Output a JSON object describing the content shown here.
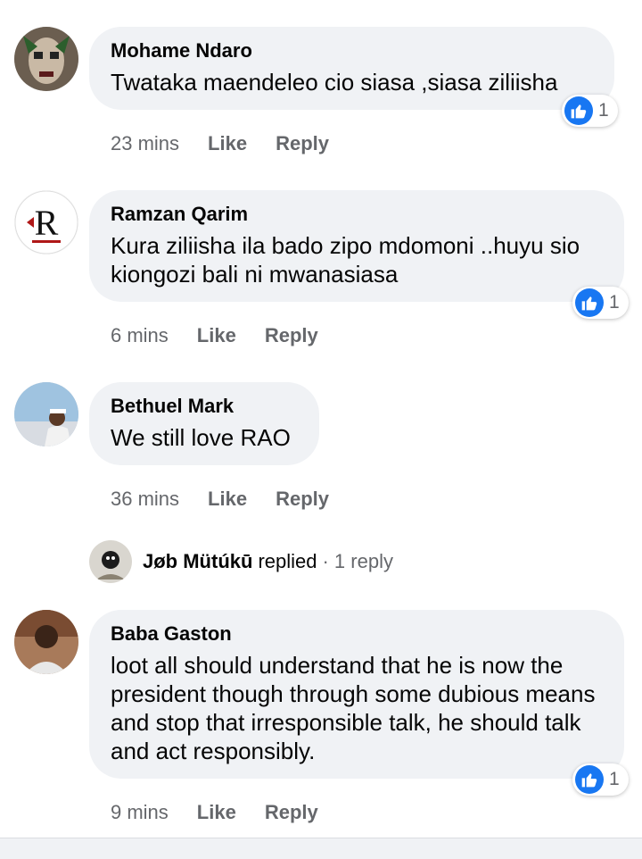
{
  "comments": [
    {
      "author": "Mohame Ndaro",
      "text": "Twataka maendeleo cio siasa ,siasa ziliisha",
      "reaction_count": "1",
      "time": "23 mins",
      "like_label": "Like",
      "reply_label": "Reply"
    },
    {
      "author": "Ramzan Qarim",
      "text": "Kura ziliisha ila bado zipo mdomoni ..huyu sio kiongozi bali ni mwanasiasa",
      "reaction_count": "1",
      "time": "6 mins",
      "like_label": "Like",
      "reply_label": "Reply"
    },
    {
      "author": "Bethuel Mark",
      "text": "We still love RAO",
      "time": "36 mins",
      "like_label": "Like",
      "reply_label": "Reply"
    },
    {
      "author": "Baba Gaston",
      "text": "loot all should understand that he is now the president though through some dubious means and stop that irresponsible talk, he should talk and act responsibly.",
      "reaction_count": "1",
      "time": "9 mins",
      "like_label": "Like",
      "reply_label": "Reply"
    }
  ],
  "replies": {
    "name": "Jøb Mütúkū",
    "verb": "replied",
    "count": "· 1 reply"
  },
  "colors": {
    "bubble": "#f0f2f5",
    "like_blue": "#1877f2",
    "meta_gray": "#65676b"
  },
  "icons": {
    "reaction": "thumbs-up-icon"
  }
}
